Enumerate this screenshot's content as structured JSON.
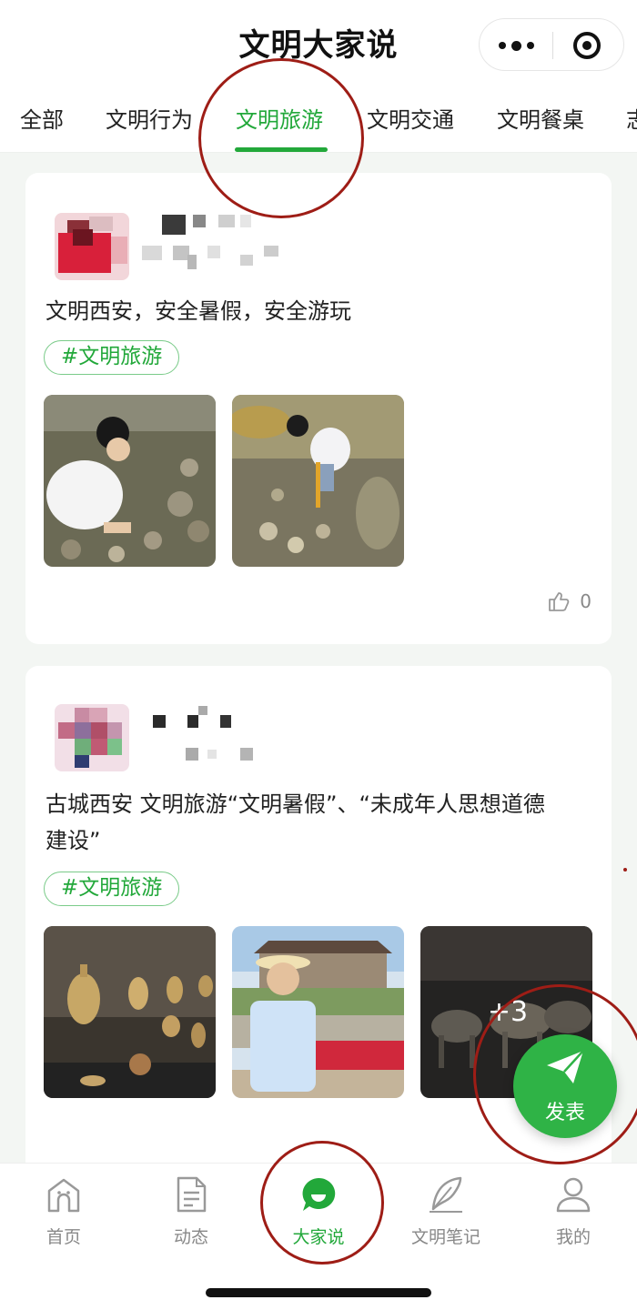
{
  "header": {
    "title": "文明大家说"
  },
  "tabs": [
    {
      "label": "全部"
    },
    {
      "label": "文明行为"
    },
    {
      "label": "文明旅游"
    },
    {
      "label": "文明交通"
    },
    {
      "label": "文明餐桌"
    },
    {
      "label": "志"
    }
  ],
  "active_tab": "文明旅游",
  "posts": [
    {
      "text": "文明西安，安全暑假，安全游玩",
      "tag": "#文明旅游",
      "likes": "0"
    },
    {
      "text_line1": "古城西安 文明旅游“文明暑假”、“未成年人思想道德",
      "text_line2": "建设”",
      "tag": "#文明旅游",
      "more_photos": "+3"
    }
  ],
  "fab": {
    "label": "发表"
  },
  "bottom_nav": [
    {
      "label": "首页",
      "icon": "home-icon"
    },
    {
      "label": "动态",
      "icon": "document-icon"
    },
    {
      "label": "大家说",
      "icon": "chat-bubble-icon"
    },
    {
      "label": "文明笔记",
      "icon": "feather-icon"
    },
    {
      "label": "我的",
      "icon": "user-icon"
    }
  ],
  "colors": {
    "accent": "#22a83a",
    "annotation": "#9e1d16"
  }
}
